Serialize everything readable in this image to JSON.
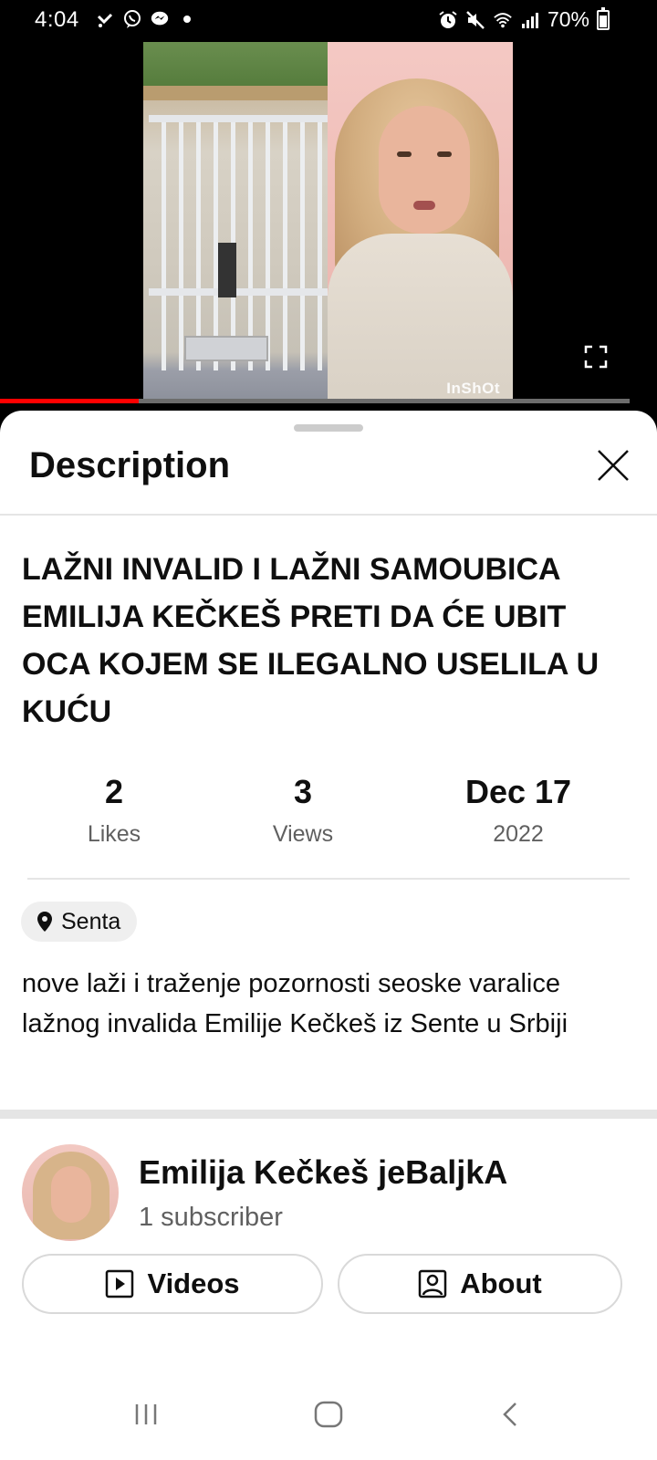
{
  "status_bar": {
    "time": "4:04",
    "battery_text": "70%",
    "left_icons": [
      "missed-call-icon",
      "viber-icon",
      "messenger-icon",
      "dot-icon"
    ],
    "right_icons": [
      "alarm-icon",
      "mute-icon",
      "wifi-icon",
      "signal-icon",
      "battery-icon"
    ]
  },
  "video": {
    "watermark": "InShOt",
    "progress_fraction": 0.22,
    "accent_color": "#ff0000"
  },
  "sheet": {
    "title": "Description",
    "video_title": "LAŽNI INVALID I LAŽNI SAMOUBICA EMILIJA KEČKEŠ PRETI DA ĆE UBIT OCA KOJEM SE ILEGALNO USELILA U KUĆU",
    "stats": {
      "likes_value": "2",
      "likes_label": "Likes",
      "views_value": "3",
      "views_label": "Views",
      "date_value": "Dec 17",
      "date_year": "2022"
    },
    "location": "Senta",
    "description": "nove laži i traženje pozornosti seoske varalice lažnog invalida Emilije Kečkeš iz Sente u Srbiji"
  },
  "channel": {
    "name": "Emilija Kečkeš jeBaljkA",
    "subscribers": "1 subscriber",
    "videos_label": "Videos",
    "about_label": "About"
  }
}
